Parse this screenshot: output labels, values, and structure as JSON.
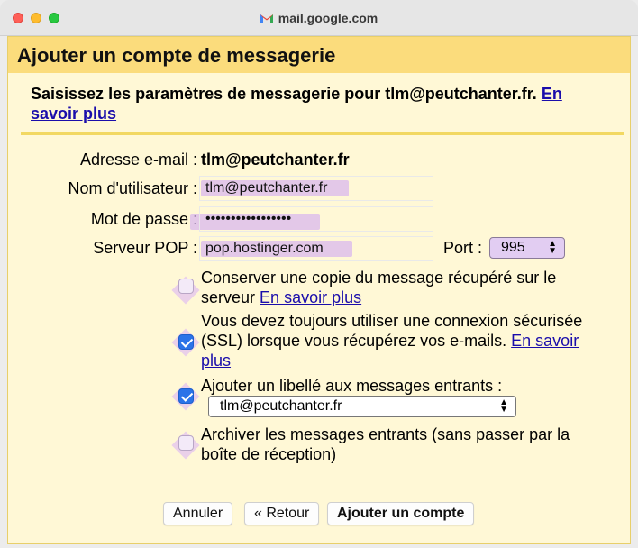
{
  "window": {
    "title": "mail.google.com",
    "icon": "gmail-icon"
  },
  "dialog": {
    "title": "Ajouter un compte de messagerie",
    "intro": "Saisissez les paramètres de messagerie pour tlm@peutchanter.fr.",
    "intro_link": "En savoir plus"
  },
  "form": {
    "email_label": "Adresse e-mail :",
    "email_value": "tlm@peutchanter.fr",
    "username_label": "Nom d'utilisateur :",
    "username_value": "tlm@peutchanter.fr",
    "password_label": "Mot de passe :",
    "password_value": "•••••••••••••••••",
    "pop_label": "Serveur POP :",
    "pop_value": "pop.hostinger.com",
    "port_label": "Port :",
    "port_value": "995"
  },
  "options": {
    "keep_copy": {
      "text": "Conserver une copie du message récupéré sur le serveur",
      "link": "En savoir plus",
      "checked": false
    },
    "ssl": {
      "text": "Vous devez toujours utiliser une connexion sécurisée (SSL) lorsque vous récupérez vos e-mails.",
      "link": "En savoir plus",
      "checked": true
    },
    "label_incoming": {
      "text": "Ajouter un libellé aux messages entrants :",
      "checked": true,
      "select_value": "tlm@peutchanter.fr"
    },
    "archive": {
      "text": "Archiver les messages entrants (sans passer par la boîte de réception)",
      "checked": false
    }
  },
  "buttons": {
    "cancel": "Annuler",
    "back": "« Retour",
    "add": "Ajouter un compte"
  },
  "colors": {
    "header": "#fbdc7c",
    "dialog_bg": "#fff8d6",
    "highlight": "#d9b8ee",
    "checkbox_checked": "#2b73e8",
    "link": "#1a0dab"
  }
}
